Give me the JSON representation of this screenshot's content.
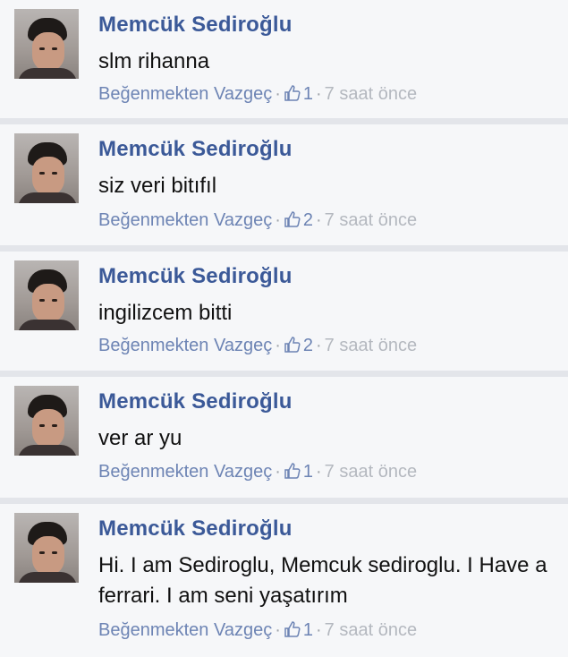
{
  "comments": [
    {
      "author": "Memcük Sediroğlu",
      "text": "slm rihanna",
      "unlike_label": "Beğenmekten Vazgeç",
      "like_count": "1",
      "timestamp": "7 saat önce"
    },
    {
      "author": "Memcük Sediroğlu",
      "text": "siz veri bitıfıl",
      "unlike_label": "Beğenmekten Vazgeç",
      "like_count": "2",
      "timestamp": "7 saat önce"
    },
    {
      "author": "Memcük Sediroğlu",
      "text": "ingilizcem bitti",
      "unlike_label": "Beğenmekten Vazgeç",
      "like_count": "2",
      "timestamp": "7 saat önce"
    },
    {
      "author": "Memcük Sediroğlu",
      "text": "ver ar yu",
      "unlike_label": "Beğenmekten Vazgeç",
      "like_count": "1",
      "timestamp": "7 saat önce"
    },
    {
      "author": "Memcük Sediroğlu",
      "text": "Hi. I am Sediroglu, Memcuk sediroglu. I Have a ferrari. I am seni yaşatırım",
      "unlike_label": "Beğenmekten Vazgeç",
      "like_count": "1",
      "timestamp": "7 saat önce"
    }
  ],
  "icons": {
    "avatar": "profile-photo",
    "like": "thumbs-up-icon"
  },
  "colors": {
    "author": "#3b5998",
    "link": "#6d84b4",
    "timestamp": "#b4b8bf",
    "background": "#f6f7f9"
  }
}
